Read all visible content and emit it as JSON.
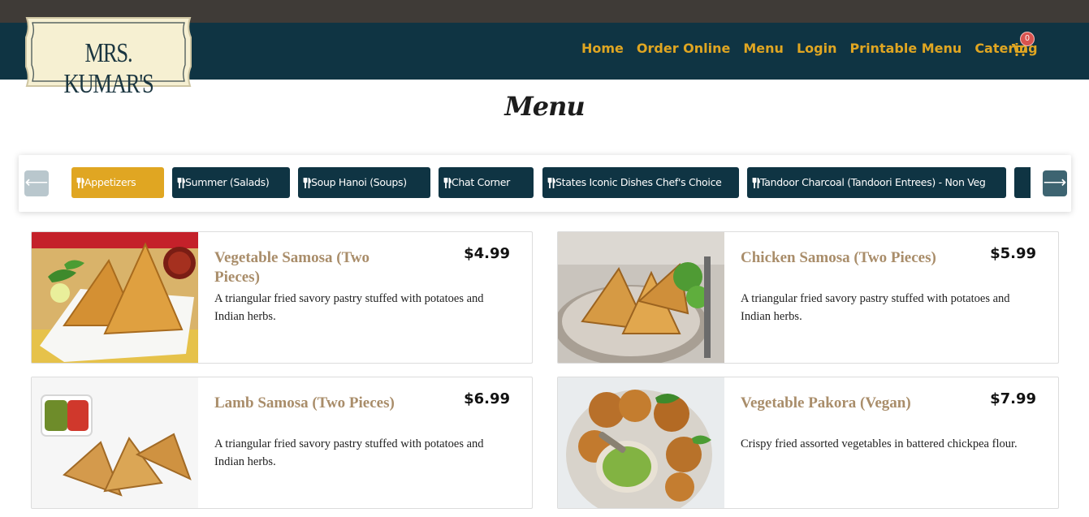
{
  "brand": {
    "name": "MRS. KUMAR'S"
  },
  "nav": {
    "links": [
      "Home",
      "Order Online",
      "Menu",
      "Login",
      "Printable Menu",
      "Catering"
    ],
    "cart_count": "0"
  },
  "page": {
    "title": "Menu"
  },
  "categories": {
    "items": [
      "Appetizers",
      "Summer (Salads)",
      "Soup Hanoi (Soups)",
      "Chat Corner",
      "States Iconic Dishes Chef's Choice",
      "Tandoor Charcoal (Tandoori Entrees) - Non Veg"
    ],
    "active": "Appetizers",
    "arrow_left": "⟵",
    "arrow_right": "⟶"
  },
  "menu_items": [
    {
      "name": "Vegetable Samosa (Two Pieces)",
      "price": "$4.99",
      "description": "A triangular fried savory pastry stuffed with potatoes and Indian herbs."
    },
    {
      "name": "Chicken Samosa (Two Pieces)",
      "price": "$5.99",
      "description": "A triangular fried savory pastry stuffed with potatoes and Indian herbs."
    },
    {
      "name": "Lamb Samosa (Two Pieces)",
      "price": "$6.99",
      "description": "A triangular fried savory pastry stuffed with potatoes and Indian herbs."
    },
    {
      "name": "Vegetable Pakora (Vegan)",
      "price": "$7.99",
      "description": "Crispy fried assorted vegetables in battered chickpea flour."
    }
  ],
  "icons": {
    "category": "fork-knife-icon",
    "cart": "shopping-cart-icon"
  },
  "colors": {
    "navbar": "#0f3443",
    "accent": "#e0a622",
    "item_name": "#a98d6a",
    "badge": "#d9534f"
  }
}
